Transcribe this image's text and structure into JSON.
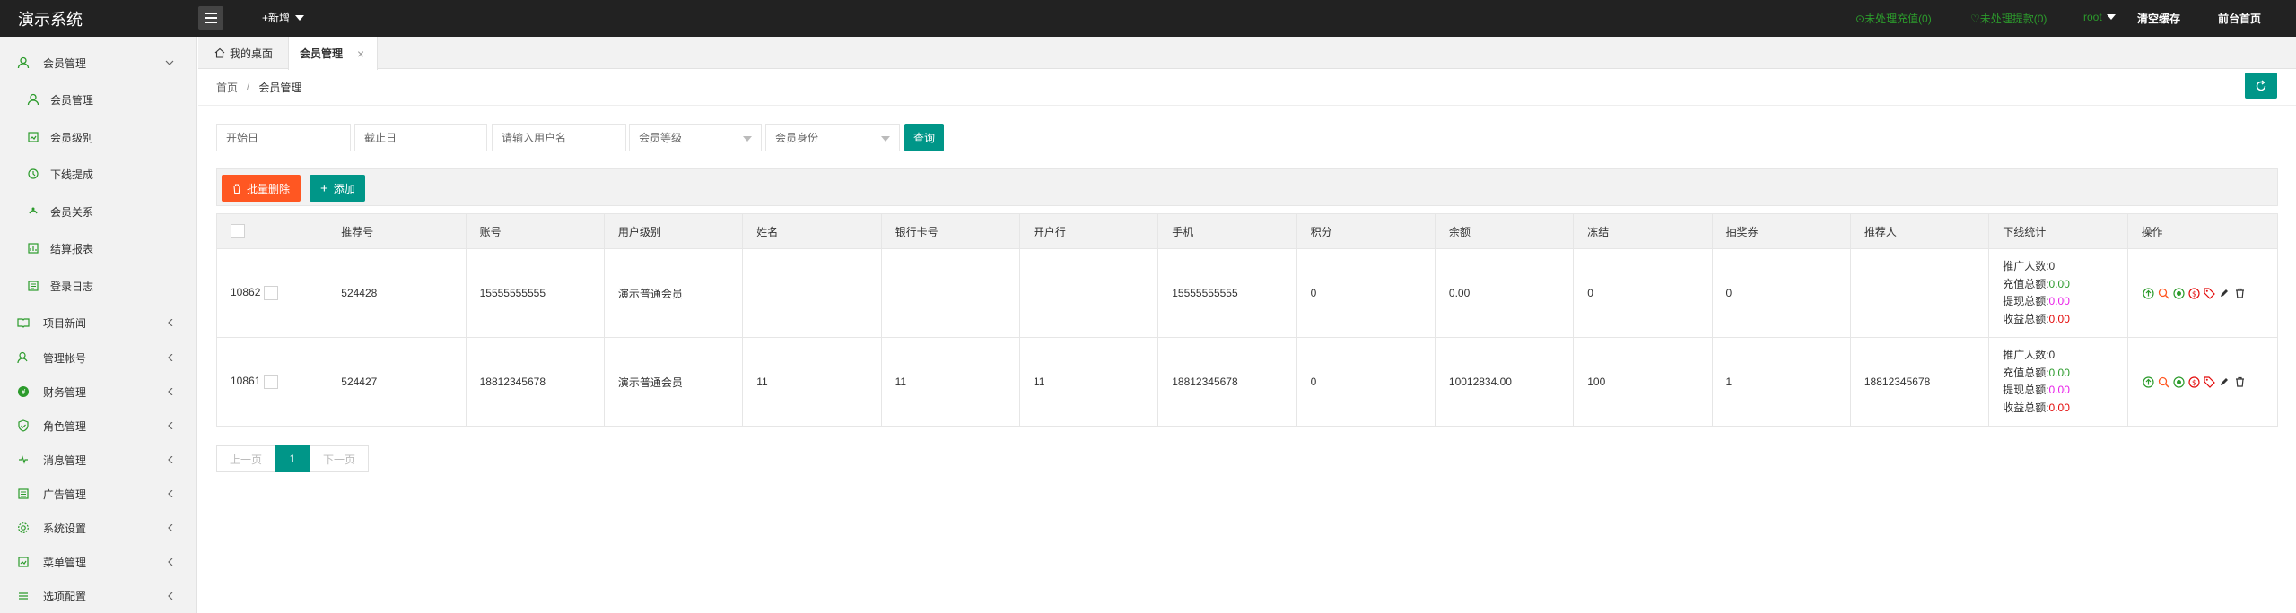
{
  "app": {
    "title": "演示系统"
  },
  "topbar": {
    "new_label": "+新增",
    "unhandled_recharge": "未处理充值(0)",
    "unhandled_withdraw": "未处理提款(0)",
    "user": "root",
    "clear_cache": "清空缓存",
    "frontend_home": "前台首页"
  },
  "sidebar": {
    "items": [
      {
        "label": "会员管理",
        "icon": "user-icon",
        "expanded": true
      },
      {
        "label": "会员管理",
        "icon": "user-icon",
        "sub": true
      },
      {
        "label": "会员级别",
        "icon": "level-icon",
        "sub": true
      },
      {
        "label": "下线提成",
        "icon": "commission-icon",
        "sub": true
      },
      {
        "label": "会员关系",
        "icon": "relation-icon",
        "sub": true
      },
      {
        "label": "结算报表",
        "icon": "report-icon",
        "sub": true
      },
      {
        "label": "登录日志",
        "icon": "log-icon",
        "sub": true
      },
      {
        "label": "项目新闻",
        "icon": "news-icon"
      },
      {
        "label": "管理帐号",
        "icon": "account-icon"
      },
      {
        "label": "财务管理",
        "icon": "finance-icon"
      },
      {
        "label": "角色管理",
        "icon": "role-icon"
      },
      {
        "label": "消息管理",
        "icon": "message-icon"
      },
      {
        "label": "广告管理",
        "icon": "ad-icon"
      },
      {
        "label": "系统设置",
        "icon": "settings-icon"
      },
      {
        "label": "菜单管理",
        "icon": "menu-icon"
      },
      {
        "label": "选项配置",
        "icon": "config-icon"
      }
    ]
  },
  "tabs": [
    {
      "label": "我的桌面",
      "icon": "home-icon"
    },
    {
      "label": "会员管理",
      "active": true
    }
  ],
  "breadcrumb": {
    "home": "首页",
    "sep": "/",
    "current": "会员管理"
  },
  "filters": {
    "start_date": "开始日",
    "end_date": "截止日",
    "username_placeholder": "请输入用户名",
    "level_select": "会员等级",
    "identity_select": "会员身份",
    "search_button": "查询"
  },
  "toolbar": {
    "batch_delete": "批量删除",
    "add": "添加"
  },
  "table": {
    "headers": [
      "",
      "推荐号",
      "账号",
      "用户级别",
      "姓名",
      "银行卡号",
      "开户行",
      "手机",
      "积分",
      "余额",
      "冻结",
      "抽奖券",
      "推荐人",
      "下线统计",
      "操作"
    ],
    "rows": [
      {
        "id": "10862",
        "ref_no": "524428",
        "account": "15555555555",
        "level": "演示普通会员",
        "name": "",
        "card": "",
        "bank": "",
        "phone": "15555555555",
        "points": "0",
        "balance": "0.00",
        "frozen": "0",
        "tickets": "0",
        "referrer": "",
        "stats": {
          "promo_label": "推广人数:",
          "promo": "0",
          "recharge_label": "充值总额:",
          "recharge": "0.00",
          "withdraw_label": "提现总额:",
          "withdraw": "0.00",
          "income_label": "收益总额:",
          "income": "0.00"
        }
      },
      {
        "id": "10861",
        "ref_no": "524427",
        "account": "18812345678",
        "level": "演示普通会员",
        "name": "11",
        "card": "11",
        "bank": "11",
        "phone": "18812345678",
        "points": "0",
        "balance": "10012834.00",
        "frozen": "100",
        "tickets": "1",
        "referrer": "18812345678",
        "stats": {
          "promo_label": "推广人数:",
          "promo": "0",
          "recharge_label": "充值总额:",
          "recharge": "0.00",
          "withdraw_label": "提现总额:",
          "withdraw": "0.00",
          "income_label": "收益总额:",
          "income": "0.00"
        }
      }
    ]
  },
  "pagination": {
    "prev": "上一页",
    "current": "1",
    "next": "下一页"
  },
  "colors": {
    "accent": "#009688",
    "danger": "#ff5722",
    "topbar": "#222222",
    "green": "#2c9b2c"
  }
}
